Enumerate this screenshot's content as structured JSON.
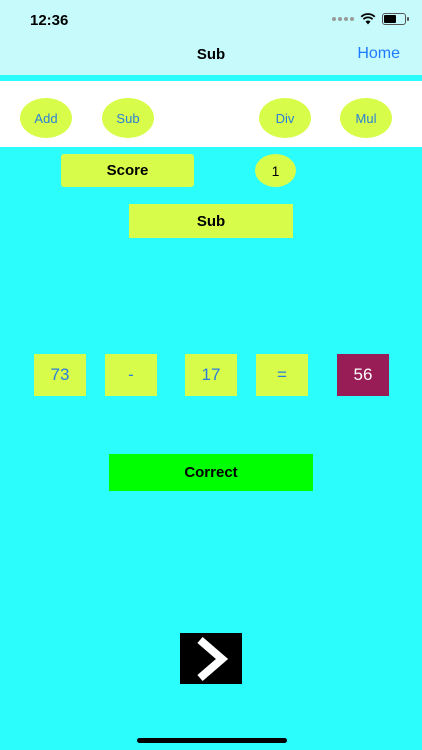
{
  "status_bar": {
    "time": "12:36"
  },
  "nav": {
    "title": "Sub",
    "home_label": "Home"
  },
  "operations": [
    {
      "label": "Add"
    },
    {
      "label": "Sub"
    },
    {
      "label": "Div"
    },
    {
      "label": "Mul"
    }
  ],
  "score": {
    "label": "Score",
    "value": "1"
  },
  "mode": {
    "label": "Sub"
  },
  "equation": {
    "left": "73",
    "operator": "-",
    "right": "17",
    "equals": "=",
    "answer": "56"
  },
  "result": {
    "label": "Correct"
  },
  "colors": {
    "background": "#2AFDFC",
    "button": "#D8FC4A",
    "answer": "#981C55",
    "correct": "#00FF00",
    "link": "#1E7BFF"
  },
  "icons": {
    "next": "chevron-right-icon"
  }
}
